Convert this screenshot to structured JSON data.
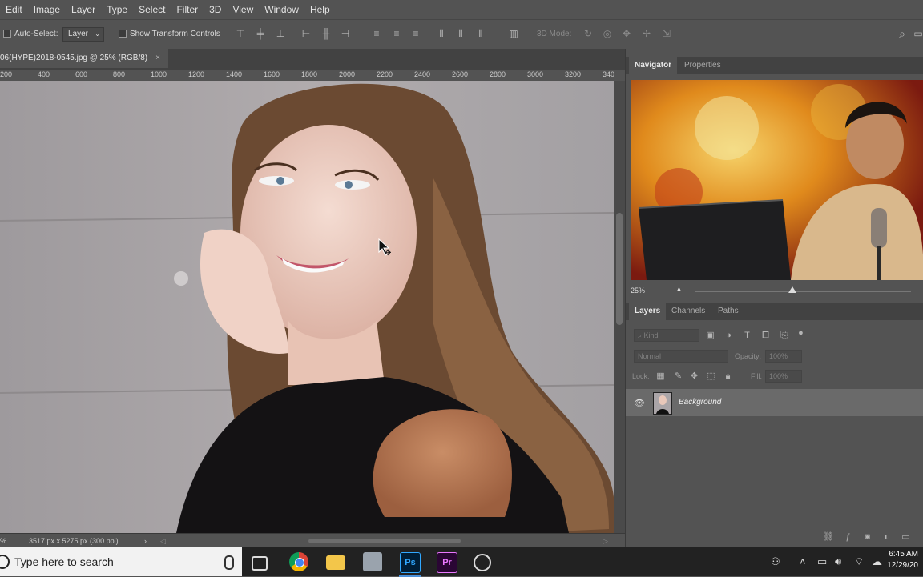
{
  "menu": [
    "Edit",
    "Image",
    "Layer",
    "Type",
    "Select",
    "Filter",
    "3D",
    "View",
    "Window",
    "Help"
  ],
  "options": {
    "auto_select_label": "Auto-Select:",
    "auto_select_value": "Layer",
    "show_transform_label": "Show Transform Controls",
    "three_d_mode_label": "3D Mode:"
  },
  "document": {
    "tab_title": "06(HYPE)2018-0545.jpg @ 25% (RGB/8)",
    "close_glyph": "×"
  },
  "ruler_ticks": [
    "200",
    "400",
    "600",
    "800",
    "1000",
    "1200",
    "1400",
    "1600",
    "1800",
    "2000",
    "2200",
    "2400",
    "2600",
    "2800",
    "3000",
    "3200",
    "340"
  ],
  "status": {
    "zoom": "%",
    "doc_size": "3517 px x 5275 px (300 ppi)"
  },
  "navigator": {
    "tabs": [
      "Navigator",
      "Properties"
    ],
    "zoom": "25%"
  },
  "layers_panel": {
    "tabs": [
      "Layers",
      "Channels",
      "Paths"
    ],
    "filter_label": "Kind",
    "blend_mode": "Normal",
    "opacity_label": "Opacity:",
    "opacity_value": "100%",
    "lock_label": "Lock:",
    "fill_label": "Fill:",
    "fill_value": "100%",
    "layers": [
      {
        "name": "Background",
        "visible": true
      }
    ]
  },
  "taskbar": {
    "search_placeholder": "Type here to search",
    "time": "6:45 AM",
    "date": "12/29/20"
  },
  "colors": {
    "ps_blue": "#31a8ff",
    "pr_purple": "#ea77ff",
    "accent": "#4a90d9"
  }
}
